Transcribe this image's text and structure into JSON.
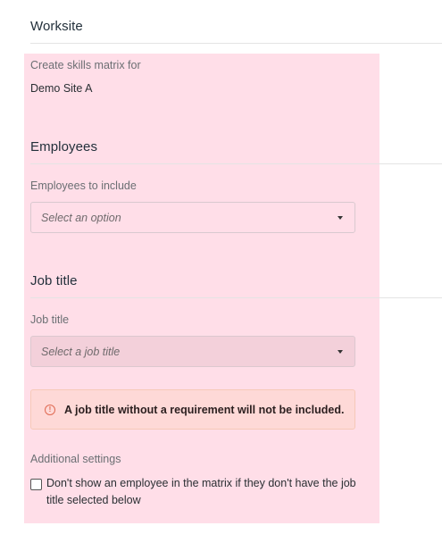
{
  "worksite": {
    "title": "Worksite",
    "create_label": "Create skills matrix for",
    "site_name": "Demo Site A"
  },
  "employees": {
    "title": "Employees",
    "field_label": "Employees to include",
    "placeholder": "Select an option"
  },
  "job_title": {
    "title": "Job title",
    "field_label": "Job title",
    "placeholder": "Select a job title"
  },
  "alert": {
    "icon": "exclamation-circle-icon",
    "glyph": "!",
    "message": "A job title without a requirement will not be included."
  },
  "additional_settings": {
    "label": "Additional settings",
    "checkbox_label": "Don't show an employee in the matrix if they don't have the job title selected below",
    "checked": false
  },
  "colors": {
    "highlight": "#ffd9e3",
    "alert_border": "#f6c9b8",
    "alert_icon": "#e06a52"
  }
}
